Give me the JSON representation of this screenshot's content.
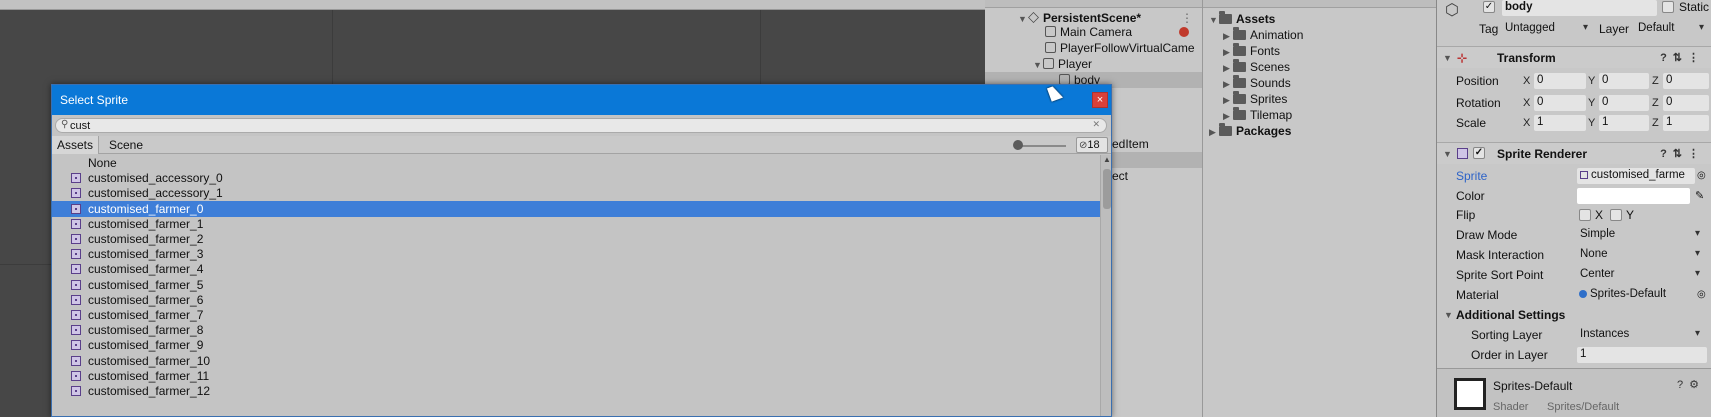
{
  "dialog": {
    "title": "Select Sprite",
    "search_value": "cust",
    "tabs": [
      "Assets",
      "Scene"
    ],
    "count": "18",
    "items": [
      "None",
      "customised_accessory_0",
      "customised_accessory_1",
      "customised_farmer_0",
      "customised_farmer_1",
      "customised_farmer_2",
      "customised_farmer_3",
      "customised_farmer_4",
      "customised_farmer_5",
      "customised_farmer_6",
      "customised_farmer_7",
      "customised_farmer_8",
      "customised_farmer_9",
      "customised_farmer_10",
      "customised_farmer_11",
      "customised_farmer_12"
    ],
    "selected_index": 3,
    "close_glyph": "×",
    "clear_glyph": "✕"
  },
  "hierarchy": {
    "rows": [
      {
        "label": "PersistentScene*",
        "bold": true
      },
      {
        "label": "Main Camera"
      },
      {
        "label": "PlayerFollowVirtualCame"
      },
      {
        "label": "Player"
      },
      {
        "label": "body"
      },
      {
        "label": "edItem"
      },
      {
        "label": "ect"
      }
    ]
  },
  "project": {
    "rows": [
      {
        "label": "Assets",
        "bold": true
      },
      {
        "label": "Animation"
      },
      {
        "label": "Fonts"
      },
      {
        "label": "Scenes"
      },
      {
        "label": "Sounds"
      },
      {
        "label": "Sprites"
      },
      {
        "label": "Tilemap"
      },
      {
        "label": "Packages",
        "bold": true
      }
    ]
  },
  "inspector": {
    "object_name": "body",
    "static_label": "Static",
    "tag_label": "Tag",
    "tag_value": "Untagged",
    "layer_label": "Layer",
    "layer_value": "Default",
    "transform": {
      "title": "Transform",
      "position_label": "Position",
      "rotation_label": "Rotation",
      "scale_label": "Scale",
      "position": [
        "0",
        "0",
        "0"
      ],
      "rotation": [
        "0",
        "0",
        "0"
      ],
      "scale": [
        "1",
        "1",
        "1"
      ]
    },
    "sprite_renderer": {
      "title": "Sprite Renderer",
      "sprite_label": "Sprite",
      "sprite_value": "customised_farme",
      "color_label": "Color",
      "flip_label": "Flip",
      "flip_x": "X",
      "flip_y": "Y",
      "draw_mode_label": "Draw Mode",
      "draw_mode_value": "Simple",
      "mask_label": "Mask Interaction",
      "mask_value": "None",
      "sort_point_label": "Sprite Sort Point",
      "sort_point_value": "Center",
      "material_label": "Material",
      "material_value": "Sprites-Default",
      "additional_label": "Additional Settings",
      "sorting_layer_label": "Sorting Layer",
      "sorting_layer_value": "Instances",
      "order_label": "Order in Layer",
      "order_value": "1"
    },
    "material_preview": {
      "name": "Sprites-Default",
      "shader_label": "Shader",
      "shader_value": "Sprites/Default"
    }
  },
  "axis_labels": [
    "X",
    "Y",
    "Z"
  ],
  "colors": {
    "dialog_title_bar": "#0a78d7",
    "selection": "#3e7ed8",
    "close_button": "#d9403a"
  }
}
